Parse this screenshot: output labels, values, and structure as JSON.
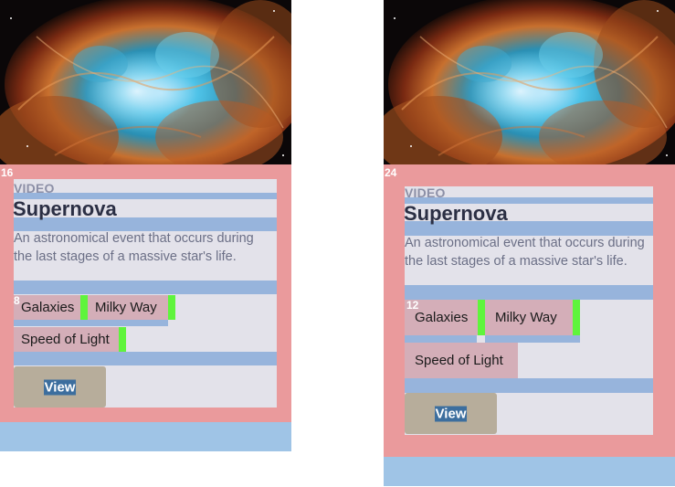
{
  "hero_image": {
    "alt": "Crab Nebula supernova remnant"
  },
  "colors": {
    "card_padding": "#ea9a9c",
    "content_bg": "#e3e2ea",
    "margin_band": "#97b4dc",
    "tag_bg": "#d4aeb8",
    "tag_gap": "#5ff43c",
    "button_bg": "#b7ad9b",
    "button_text_bg": "#3c6e9e",
    "footer": "#9fc4e6"
  },
  "cards": [
    {
      "padding_label": "16",
      "gap_label": "8",
      "eyebrow": "VIDEO",
      "title": "Supernova",
      "description": "An astronomical event that occurs during the last stages of a massive star's life.",
      "tags": [
        "Galaxies",
        "Milky Way",
        "Speed of Light"
      ],
      "button_label": "View"
    },
    {
      "padding_label": "24",
      "gap_label": "12",
      "eyebrow": "VIDEO",
      "title": "Supernova",
      "description": "An astronomical event that occurs during the last stages of a massive star's life.",
      "tags": [
        "Galaxies",
        "Milky Way",
        "Speed of Light"
      ],
      "button_label": "View"
    }
  ]
}
